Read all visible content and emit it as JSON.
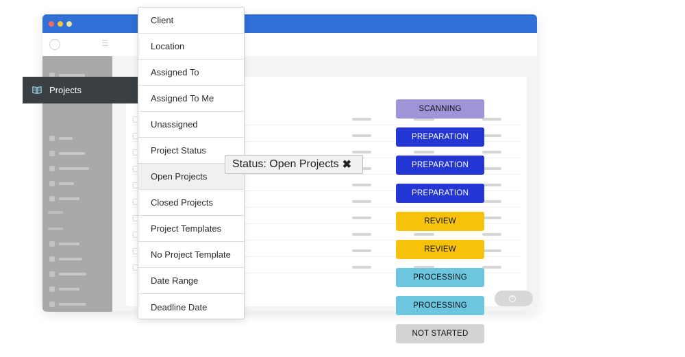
{
  "nav": {
    "active_label": "Projects",
    "active_icon": "book-open-icon"
  },
  "filter_menu": {
    "items": [
      "Client",
      "Location",
      "Assigned To",
      "Assigned To Me",
      "Unassigned",
      "Project Status",
      "Open Projects",
      "Closed Projects",
      "Project Templates",
      "No Project Template",
      "Date Range",
      "Deadline Date"
    ],
    "highlighted": "Open Projects"
  },
  "active_filter": {
    "label": "Status: Open Projects",
    "remove_glyph": "✖"
  },
  "status_badges": [
    {
      "label": "SCANNING",
      "bg": "#9d95d8",
      "fg": "#111111"
    },
    {
      "label": "PREPARATION",
      "bg": "#2436d4",
      "fg": "#ffffff"
    },
    {
      "label": "PREPARATION",
      "bg": "#2436d4",
      "fg": "#ffffff"
    },
    {
      "label": "PREPARATION",
      "bg": "#2436d4",
      "fg": "#ffffff"
    },
    {
      "label": "REVIEW",
      "bg": "#f6c30a",
      "fg": "#111111"
    },
    {
      "label": "REVIEW",
      "bg": "#f6c30a",
      "fg": "#111111"
    },
    {
      "label": "PROCESSING",
      "bg": "#6cc6df",
      "fg": "#111111"
    },
    {
      "label": "PROCESSING",
      "bg": "#6cc6df",
      "fg": "#111111"
    },
    {
      "label": "NOT STARTED",
      "bg": "#d3d3d3",
      "fg": "#111111"
    }
  ],
  "colors": {
    "titlebar": "#2f6fd6",
    "nav_active_bg": "#3a3f44"
  }
}
